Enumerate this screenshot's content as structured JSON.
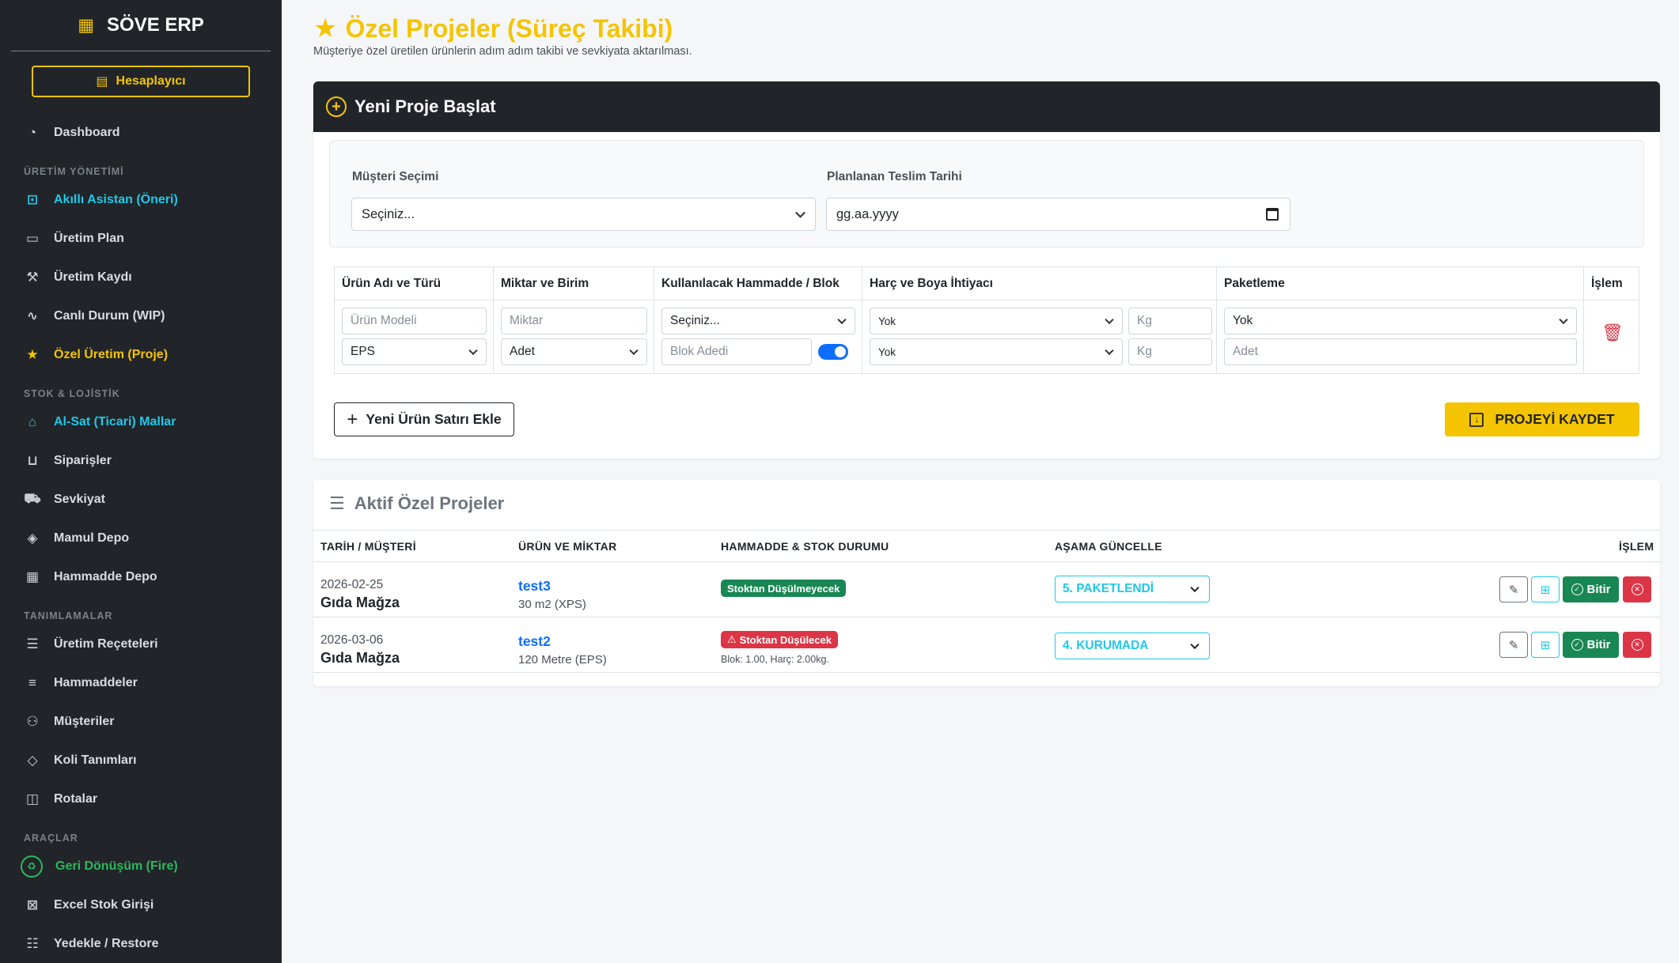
{
  "sidebar": {
    "brand": "SÖVE ERP",
    "calculator": "Hesaplayıcı",
    "items": [
      {
        "label": "Dashboard"
      },
      {
        "heading": "ÜRETİM YÖNETİMİ"
      },
      {
        "label": "Akıllı Asistan (Öneri)"
      },
      {
        "label": "Üretim Plan"
      },
      {
        "label": "Üretim Kaydı"
      },
      {
        "label": "Canlı Durum (WIP)"
      },
      {
        "label": "Özel Üretim (Proje)"
      },
      {
        "heading": "STOK & LOJİSTİK"
      },
      {
        "label": "Al-Sat (Ticari) Mallar"
      },
      {
        "label": "Siparişler"
      },
      {
        "label": "Sevkiyat"
      },
      {
        "label": "Mamul Depo"
      },
      {
        "label": "Hammadde Depo"
      },
      {
        "heading": "TANIMLAMALAR"
      },
      {
        "label": "Üretim Reçeteleri"
      },
      {
        "label": "Hammaddeler"
      },
      {
        "label": "Müşteriler"
      },
      {
        "label": "Koli Tanımları"
      },
      {
        "label": "Rotalar"
      },
      {
        "heading": "ARAÇLAR"
      },
      {
        "label": "Geri Dönüşüm (Fire)"
      },
      {
        "label": "Excel Stok Girişi"
      },
      {
        "label": "Yedekle / Restore"
      }
    ]
  },
  "page": {
    "title": "Özel Projeler (Süreç Takibi)",
    "subtitle": "Müşteriye özel üretilen ürünlerin adım adım takibi ve sevkiyata aktarılması."
  },
  "new_project": {
    "header": "Yeni Proje Başlat",
    "customer_label": "Müşteri Seçimi",
    "customer_value": "Seçiniz...",
    "date_label": "Planlanan Teslim Tarihi",
    "date_value": "gg.aa.yyyy",
    "columns": [
      "Ürün Adı ve Türü",
      "Miktar ve Birim",
      "Kullanılacak Hammadde / Blok",
      "Harç ve Boya İhtiyacı",
      "Paketleme",
      "İşlem"
    ],
    "row": {
      "product_model_placeholder": "Ürün Modeli",
      "product_type": "EPS",
      "quantity_placeholder": "Miktar",
      "unit": "Adet",
      "material": "Seçiniz...",
      "block_placeholder": "Blok Adedi",
      "mortar": "Yok",
      "mortar_kg_placeholder": "Kg",
      "paint": "Yok",
      "paint_kg_placeholder": "Kg",
      "packaging": "Yok",
      "packaging_qty_placeholder": "Adet"
    },
    "add_row_button": "Yeni Ürün Satırı Ekle",
    "save_button": "PROJEYİ KAYDET"
  },
  "active_projects": {
    "title": "Aktif Özel Projeler",
    "columns": [
      "TARİH / MÜŞTERİ",
      "ÜRÜN VE MİKTAR",
      "HAMMADDE & STOK DURUMU",
      "AŞAMA GÜNCELLE",
      "İŞLEM"
    ],
    "finish_label": "Bitir",
    "rows": [
      {
        "date": "2026-02-25",
        "customer": "Gıda Mağza",
        "product": "test3",
        "qty": "30 m2 (XPS)",
        "stock_badge": "Stoktan Düşülmeyecek",
        "stock_note": "",
        "stage": "5. PAKETLENDİ"
      },
      {
        "date": "2026-03-06",
        "customer": "Gıda Mağza",
        "product": "test2",
        "qty": "120 Metre (EPS)",
        "stock_badge": "Stoktan Düşülecek",
        "stock_note": "Blok: 1.00, Harç: 2.00kg.",
        "stage": "4. KURUMADA"
      }
    ]
  },
  "colors": {
    "accent": "#f5c400",
    "sidebar_bg": "#212529",
    "info": "#1fc8ea",
    "success": "#198754",
    "danger": "#dc3545",
    "primary": "#0d6efd"
  },
  "icons": [
    "building-icon",
    "calculator-icon",
    "dashboard-icon",
    "robot-icon",
    "calendar-icon",
    "hammer-icon",
    "activity-icon",
    "star-icon",
    "shop-icon",
    "cart-icon",
    "truck-icon",
    "box-icon",
    "grid-icon",
    "list-icon",
    "people-icon",
    "package-icon",
    "columns-icon",
    "recycle-icon",
    "excel-icon",
    "server-icon",
    "plus-circle-icon",
    "trash-icon",
    "save-icon",
    "edit-icon",
    "check-circle-icon",
    "x-circle-icon"
  ]
}
